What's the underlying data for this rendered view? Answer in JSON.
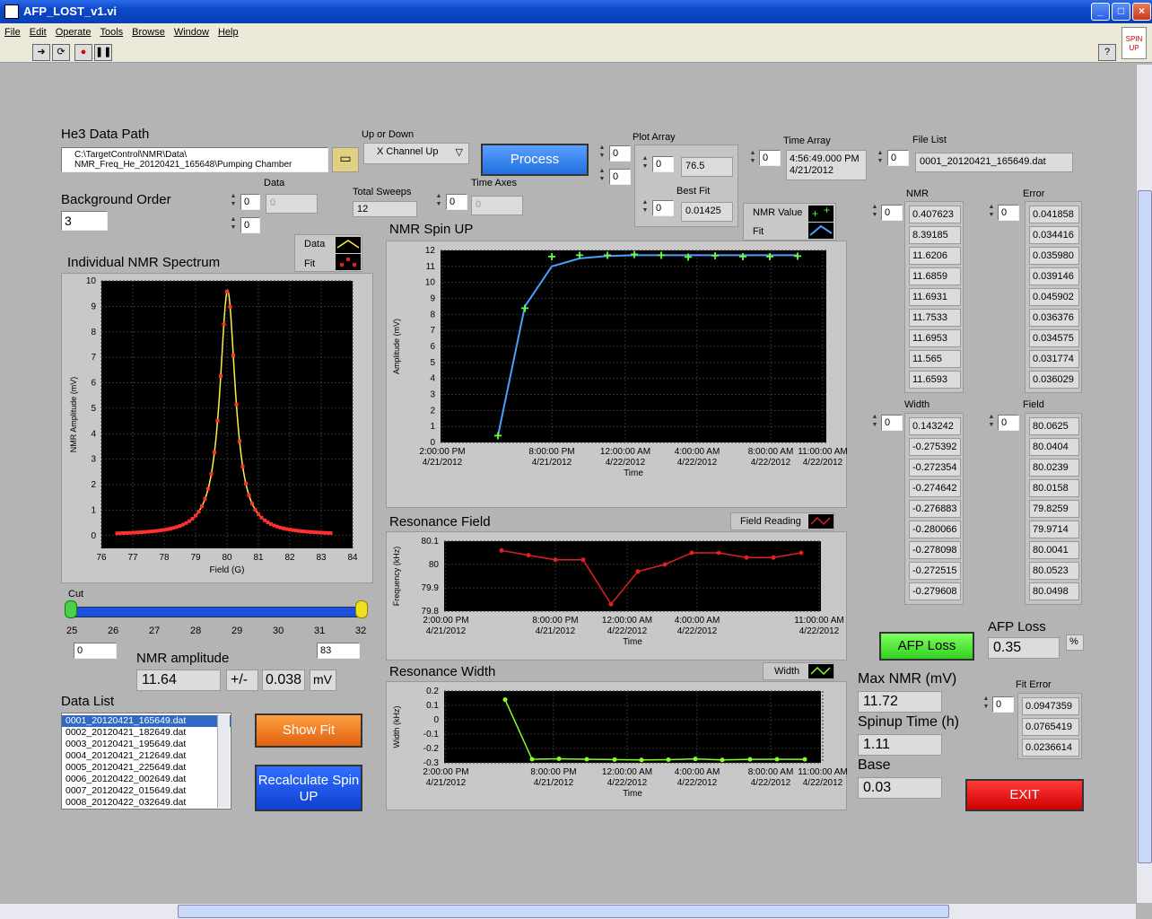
{
  "window": {
    "title": "AFP_LOST_v1.vi"
  },
  "menu": [
    "File",
    "Edit",
    "Operate",
    "Tools",
    "Browse",
    "Window",
    "Help"
  ],
  "toolbar_badge": "SPIN UP",
  "he3": {
    "label": "He3 Data Path",
    "path_line1": "C:\\TargetControl\\NMR\\Data\\",
    "path_line2": "NMR_Freq_He_20120421_165648\\Pumping Chamber"
  },
  "up_down": {
    "label": "Up or Down",
    "value": "X Channel Up"
  },
  "process_label": "Process",
  "plot_array": {
    "label": "Plot Array",
    "idx1": "0",
    "idx2": "0",
    "inner1": "0",
    "value1": "76.5",
    "best_fit_label": "Best Fit",
    "inner2": "0",
    "value2": "0.01425"
  },
  "time_array": {
    "label": "Time Array",
    "idx": "0",
    "line1": "4:56:49.000 PM",
    "line2": "4/21/2012"
  },
  "file_list": {
    "label": "File List",
    "idx": "0",
    "value": "0001_20120421_165649.dat"
  },
  "background": {
    "label": "Background Order",
    "value": "3"
  },
  "data_arr": {
    "label": "Data",
    "idx1": "0",
    "idx2": "0",
    "value": "0"
  },
  "total_sweeps": {
    "label": "Total Sweeps",
    "value": "12"
  },
  "time_axes": {
    "label": "Time Axes",
    "idx": "0",
    "value": "0"
  },
  "spectrum": {
    "title": "Individual NMR Spectrum",
    "legend_data": "Data",
    "legend_fit": "Fit",
    "xlabel": "Field (G)",
    "ylabel": "NMR Amplitude (mV)",
    "xticks": [
      "76",
      "77",
      "78",
      "79",
      "80",
      "81",
      "82",
      "83",
      "84"
    ],
    "yticks": [
      "0",
      "1",
      "2",
      "3",
      "4",
      "5",
      "6",
      "7",
      "8",
      "9",
      "10"
    ]
  },
  "cut": {
    "label": "Cut",
    "ticks": [
      "25",
      "26",
      "27",
      "28",
      "29",
      "30",
      "31",
      "32"
    ],
    "min": "0",
    "max": "83"
  },
  "nmr_amp": {
    "label": "NMR amplitude",
    "value": "11.64",
    "pm": "+/-",
    "err": "0.038",
    "unit": "mV"
  },
  "data_list": {
    "label": "Data List",
    "items": [
      "0001_20120421_165649.dat",
      "0002_20120421_182649.dat",
      "0003_20120421_195649.dat",
      "0004_20120421_212649.dat",
      "0005_20120421_225649.dat",
      "0006_20120422_002649.dat",
      "0007_20120422_015649.dat",
      "0008_20120422_032649.dat"
    ]
  },
  "show_fit_label": "Show Fit",
  "recalc_label": "Recalculate Spin UP",
  "spinup": {
    "title": "NMR Spin UP",
    "legend_value": "NMR Value",
    "legend_fit": "Fit",
    "ylabel": "Amplitude (mV)",
    "xlabel": "Time",
    "yticks": [
      "0",
      "1",
      "2",
      "3",
      "4",
      "5",
      "6",
      "7",
      "8",
      "9",
      "10",
      "11",
      "12"
    ],
    "xticks": [
      [
        "2:00:00 PM",
        "4/21/2012"
      ],
      [
        "8:00:00 PM",
        "4/21/2012"
      ],
      [
        "12:00:00 AM",
        "4/22/2012"
      ],
      [
        "4:00:00 AM",
        "4/22/2012"
      ],
      [
        "8:00:00 AM",
        "4/22/2012"
      ],
      [
        "11:00:00 AM",
        "4/22/2012"
      ]
    ]
  },
  "resfield": {
    "title": "Resonance Field",
    "legend": "Field Reading",
    "ylabel": "Frequency (kHz)",
    "xlabel": "Time",
    "yticks": [
      "79.8",
      "79.9",
      "80",
      "80.1"
    ],
    "xticks": [
      [
        "2:00:00 PM",
        "4/21/2012"
      ],
      [
        "8:00:00 PM",
        "4/21/2012"
      ],
      [
        "12:00:00 AM",
        "4/22/2012"
      ],
      [
        "4:00:00 AM",
        "4/22/2012"
      ],
      [
        "11:00:00 AM",
        "4/22/2012"
      ]
    ]
  },
  "reswidth": {
    "title": "Resonance Width",
    "legend": "Width",
    "ylabel": "Width (kHz)",
    "xlabel": "Time",
    "yticks": [
      "-0.3",
      "-0.2",
      "-0.1",
      "0",
      "0.1",
      "0.2"
    ],
    "xticks": [
      [
        "2:00:00 PM",
        "4/21/2012"
      ],
      [
        "8:00:00 PM",
        "4/21/2012"
      ],
      [
        "12:00:00 AM",
        "4/22/2012"
      ],
      [
        "4:00:00 AM",
        "4/22/2012"
      ],
      [
        "8:00:00 AM",
        "4/22/2012"
      ],
      [
        "11:00:00 AM",
        "4/22/2012"
      ]
    ]
  },
  "nmr": {
    "label": "NMR",
    "idx": "0",
    "values": [
      "0.407623",
      "8.39185",
      "11.6206",
      "11.6859",
      "11.6931",
      "11.7533",
      "11.6953",
      "11.565",
      "11.6593"
    ]
  },
  "error": {
    "label": "Error",
    "idx": "0",
    "values": [
      "0.041858",
      "0.034416",
      "0.035980",
      "0.039146",
      "0.045902",
      "0.036376",
      "0.034575",
      "0.031774",
      "0.036029"
    ]
  },
  "width": {
    "label": "Width",
    "idx": "0",
    "values": [
      "0.143242",
      "-0.275392",
      "-0.272354",
      "-0.274642",
      "-0.276883",
      "-0.280066",
      "-0.278098",
      "-0.272515",
      "-0.279608"
    ]
  },
  "field": {
    "label": "Field",
    "idx": "0",
    "values": [
      "80.0625",
      "80.0404",
      "80.0239",
      "80.0158",
      "79.8259",
      "79.9714",
      "80.0041",
      "80.0523",
      "80.0498"
    ]
  },
  "afp": {
    "button": "AFP Loss",
    "label": "AFP Loss",
    "value": "0.35",
    "unit": "%"
  },
  "max_nmr": {
    "label": "Max NMR (mV)",
    "value": "11.72"
  },
  "spinup_time": {
    "label": "Spinup Time (h)",
    "value": "1.11"
  },
  "base": {
    "label": "Base",
    "value": "0.03"
  },
  "fit_error": {
    "label": "Fit Error",
    "idx": "0",
    "values": [
      "0.0947359",
      "0.0765419",
      "0.0236614"
    ]
  },
  "exit_label": "EXIT",
  "chart_data": [
    {
      "type": "line",
      "title": "Individual NMR Spectrum",
      "xlabel": "Field (G)",
      "ylabel": "NMR Amplitude (mV)",
      "xlim": [
        76,
        84
      ],
      "ylim": [
        -0.5,
        10
      ],
      "series": [
        {
          "name": "Data",
          "x": [
            76.5,
            77,
            77.5,
            78,
            78.5,
            79,
            79.3,
            79.6,
            79.8,
            80,
            80.2,
            80.4,
            80.7,
            81,
            81.5,
            82,
            82.5,
            83,
            83.3
          ],
          "y": [
            0.1,
            0.05,
            0.05,
            0.15,
            0.4,
            1.0,
            1.8,
            4.0,
            7.0,
            9.6,
            7.0,
            4.0,
            2.0,
            1.0,
            0.4,
            0.2,
            0.05,
            0.05,
            0.25
          ]
        },
        {
          "name": "Fit",
          "x": [
            76.5,
            77,
            77.5,
            78,
            78.5,
            79,
            79.3,
            79.6,
            79.8,
            80,
            80.2,
            80.4,
            80.7,
            81,
            81.5,
            82,
            82.5,
            83,
            83.3
          ],
          "y": [
            0.1,
            0.05,
            0.05,
            0.15,
            0.4,
            1.0,
            1.8,
            4.0,
            7.0,
            9.6,
            7.0,
            4.0,
            2.0,
            1.0,
            0.4,
            0.2,
            0.05,
            0.05,
            0.25
          ]
        }
      ]
    },
    {
      "type": "line",
      "title": "NMR Spin UP",
      "xlabel": "Time",
      "ylabel": "Amplitude (mV)",
      "ylim": [
        0,
        12
      ],
      "x": [
        "4:56 PM",
        "6:26 PM",
        "7:56 PM",
        "9:26 PM",
        "10:56 PM",
        "12:26 AM",
        "1:56 AM",
        "3:26 AM",
        "4:56 AM",
        "6:26 AM",
        "7:56 AM",
        "9:26 AM"
      ],
      "series": [
        {
          "name": "NMR Value",
          "values": [
            0.41,
            8.39,
            11.62,
            11.69,
            11.69,
            11.75,
            11.7,
            11.57,
            11.66,
            11.62,
            11.6,
            11.64
          ]
        },
        {
          "name": "Fit",
          "values": [
            0.41,
            8.5,
            11.0,
            11.5,
            11.65,
            11.7,
            11.7,
            11.7,
            11.7,
            11.7,
            11.7,
            11.7
          ]
        }
      ]
    },
    {
      "type": "line",
      "title": "Resonance Field",
      "xlabel": "Time",
      "ylabel": "Frequency (kHz)",
      "ylim": [
        79.8,
        80.1
      ],
      "x": [
        "4:56 PM",
        "6:26 PM",
        "7:56 PM",
        "9:26 PM",
        "10:56 PM",
        "12:26 AM",
        "1:56 AM",
        "3:26 AM",
        "4:56 AM",
        "6:26 AM",
        "7:56 AM",
        "9:26 AM"
      ],
      "series": [
        {
          "name": "Field Reading",
          "values": [
            80.06,
            80.04,
            80.02,
            80.02,
            79.83,
            79.97,
            80.0,
            80.05,
            80.05,
            80.03,
            80.03,
            80.05
          ]
        }
      ]
    },
    {
      "type": "line",
      "title": "Resonance Width",
      "xlabel": "Time",
      "ylabel": "Width (kHz)",
      "ylim": [
        -0.3,
        0.2
      ],
      "x": [
        "4:56 PM",
        "6:26 PM",
        "7:56 PM",
        "9:26 PM",
        "10:56 PM",
        "12:26 AM",
        "1:56 AM",
        "3:26 AM",
        "4:56 AM",
        "6:26 AM",
        "7:56 AM",
        "9:26 AM"
      ],
      "series": [
        {
          "name": "Width",
          "values": [
            0.14,
            -0.275,
            -0.272,
            -0.275,
            -0.277,
            -0.28,
            -0.278,
            -0.273,
            -0.28,
            -0.276,
            -0.275,
            -0.276
          ]
        }
      ]
    }
  ]
}
